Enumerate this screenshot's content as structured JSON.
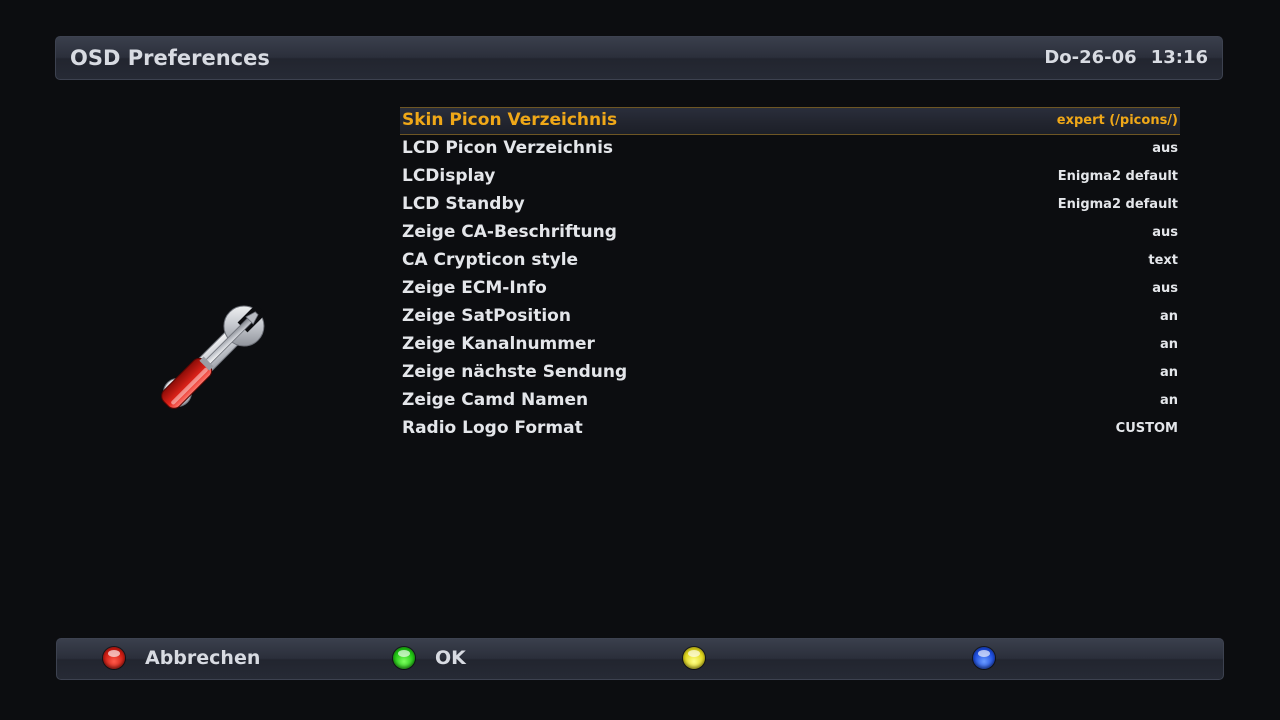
{
  "header": {
    "title": "OSD Preferences",
    "date": "Do-26-06",
    "time": "13:16"
  },
  "icon": {
    "name": "wrench-screwdriver-icon"
  },
  "menu": {
    "selected_index": 0,
    "selected_color": "#f0a818",
    "items": [
      {
        "label": "Skin Picon Verzeichnis",
        "value": "expert (/picons/)"
      },
      {
        "label": "LCD Picon Verzeichnis",
        "value": "aus"
      },
      {
        "label": "LCDisplay",
        "value": "Enigma2 default"
      },
      {
        "label": "LCD Standby",
        "value": "Enigma2 default"
      },
      {
        "label": "Zeige CA-Beschriftung",
        "value": "aus"
      },
      {
        "label": "CA Crypticon style",
        "value": "text"
      },
      {
        "label": "Zeige ECM-Info",
        "value": "aus"
      },
      {
        "label": "Zeige SatPosition",
        "value": "an"
      },
      {
        "label": "Zeige Kanalnummer",
        "value": "an"
      },
      {
        "label": "Zeige nächste Sendung",
        "value": "an"
      },
      {
        "label": "Zeige Camd Namen",
        "value": "an"
      },
      {
        "label": "Radio Logo Format",
        "value": "CUSTOM"
      }
    ]
  },
  "buttons": {
    "red": {
      "label": "Abbrechen",
      "color": "#d01e14"
    },
    "green": {
      "label": "OK",
      "color": "#22c814"
    },
    "yellow": {
      "label": "",
      "color": "#e2d81e"
    },
    "blue": {
      "label": "",
      "color": "#1f4fe0"
    }
  }
}
